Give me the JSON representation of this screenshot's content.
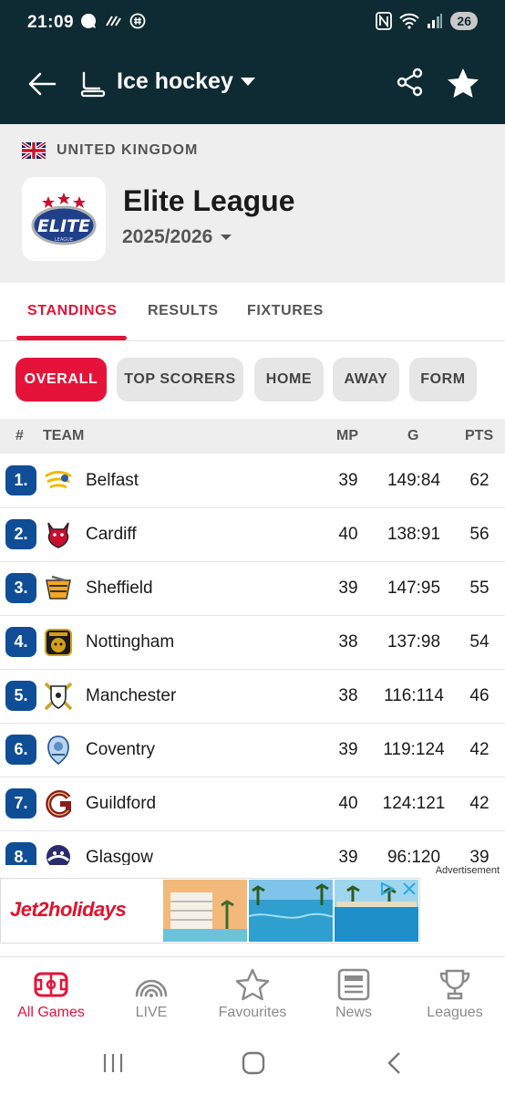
{
  "status_bar": {
    "time": "21:09",
    "battery": "26"
  },
  "app_bar": {
    "title": "Ice hockey"
  },
  "league": {
    "country": "UNITED KINGDOM",
    "name": "Elite League",
    "season": "2025/2026",
    "logo_text": "ELITE"
  },
  "tabs": [
    {
      "label": "STANDINGS",
      "active": true
    },
    {
      "label": "RESULTS",
      "active": false
    },
    {
      "label": "FIXTURES",
      "active": false
    }
  ],
  "filters": [
    {
      "label": "OVERALL",
      "active": true
    },
    {
      "label": "TOP SCORERS",
      "active": false
    },
    {
      "label": "HOME",
      "active": false
    },
    {
      "label": "AWAY",
      "active": false
    },
    {
      "label": "FORM",
      "active": false
    }
  ],
  "table": {
    "headers": {
      "rank": "#",
      "team": "TEAM",
      "mp": "MP",
      "g": "G",
      "pts": "PTS"
    },
    "rows": [
      {
        "rank": "1.",
        "team": "Belfast",
        "mp": "39",
        "g": "149:84",
        "pts": "62",
        "logo_color": "#f2b807"
      },
      {
        "rank": "2.",
        "team": "Cardiff",
        "mp": "40",
        "g": "138:91",
        "pts": "56",
        "logo_color": "#c8102e"
      },
      {
        "rank": "3.",
        "team": "Sheffield",
        "mp": "39",
        "g": "147:95",
        "pts": "55",
        "logo_color": "#f5a623"
      },
      {
        "rank": "4.",
        "team": "Nottingham",
        "mp": "38",
        "g": "137:98",
        "pts": "54",
        "logo_color": "#d4a017"
      },
      {
        "rank": "5.",
        "team": "Manchester",
        "mp": "38",
        "g": "116:114",
        "pts": "46",
        "logo_color": "#c9a227"
      },
      {
        "rank": "6.",
        "team": "Coventry",
        "mp": "39",
        "g": "119:124",
        "pts": "42",
        "logo_color": "#5b8fc7"
      },
      {
        "rank": "7.",
        "team": "Guildford",
        "mp": "40",
        "g": "124:121",
        "pts": "42",
        "logo_color": "#8b1a1a"
      },
      {
        "rank": "8.",
        "team": "Glasgow",
        "mp": "39",
        "g": "96:120",
        "pts": "39",
        "logo_color": "#2a2a6e"
      }
    ]
  },
  "ad": {
    "label": "Advertisement",
    "brand": "Jet2holidays"
  },
  "bottom_nav": [
    {
      "label": "All Games",
      "icon": "rink-icon",
      "active": true
    },
    {
      "label": "LIVE",
      "icon": "live-icon",
      "active": false
    },
    {
      "label": "Favourites",
      "icon": "star-icon",
      "active": false
    },
    {
      "label": "News",
      "icon": "news-icon",
      "active": false
    },
    {
      "label": "Leagues",
      "icon": "trophy-icon",
      "active": false
    }
  ],
  "colors": {
    "accent": "#e5133a",
    "header_bg": "#0e2a33",
    "rank_badge": "#0f4e97"
  }
}
